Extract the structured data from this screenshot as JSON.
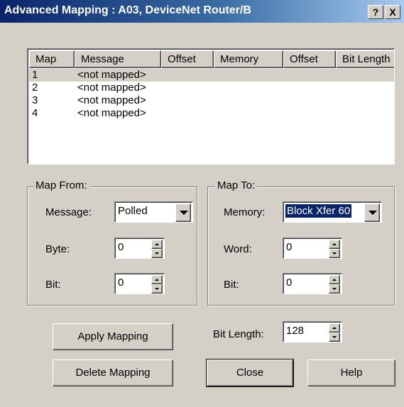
{
  "window": {
    "title": "Advanced Mapping : A03, DeviceNet Router/B",
    "help_glyph": "?",
    "close_glyph": "X"
  },
  "table": {
    "columns": [
      "Map",
      "Message",
      "Offset",
      "Memory",
      "Offset",
      "Bit Length"
    ],
    "rows": [
      {
        "map": "1",
        "message": "<not mapped>"
      },
      {
        "map": "2",
        "message": "<not mapped>"
      },
      {
        "map": "3",
        "message": "<not mapped>"
      },
      {
        "map": "4",
        "message": "<not mapped>"
      }
    ],
    "selected_row": 0
  },
  "map_from": {
    "legend": "Map From:",
    "message_label": "Message:",
    "message_value": "Polled",
    "byte_label": "Byte:",
    "byte_value": "0",
    "bit_label": "Bit:",
    "bit_value": "0"
  },
  "map_to": {
    "legend": "Map To:",
    "memory_label": "Memory:",
    "memory_value": "Block Xfer 60",
    "word_label": "Word:",
    "word_value": "0",
    "bit_label": "Bit:",
    "bit_value": "0"
  },
  "bit_length": {
    "label": "Bit Length:",
    "value": "128"
  },
  "buttons": {
    "apply": "Apply Mapping",
    "delete": "Delete Mapping",
    "close": "Close",
    "help": "Help"
  },
  "colors": {
    "title_bar": "#0a246a",
    "dialog_face": "#d4d0c8",
    "selection": "#0a246a"
  }
}
